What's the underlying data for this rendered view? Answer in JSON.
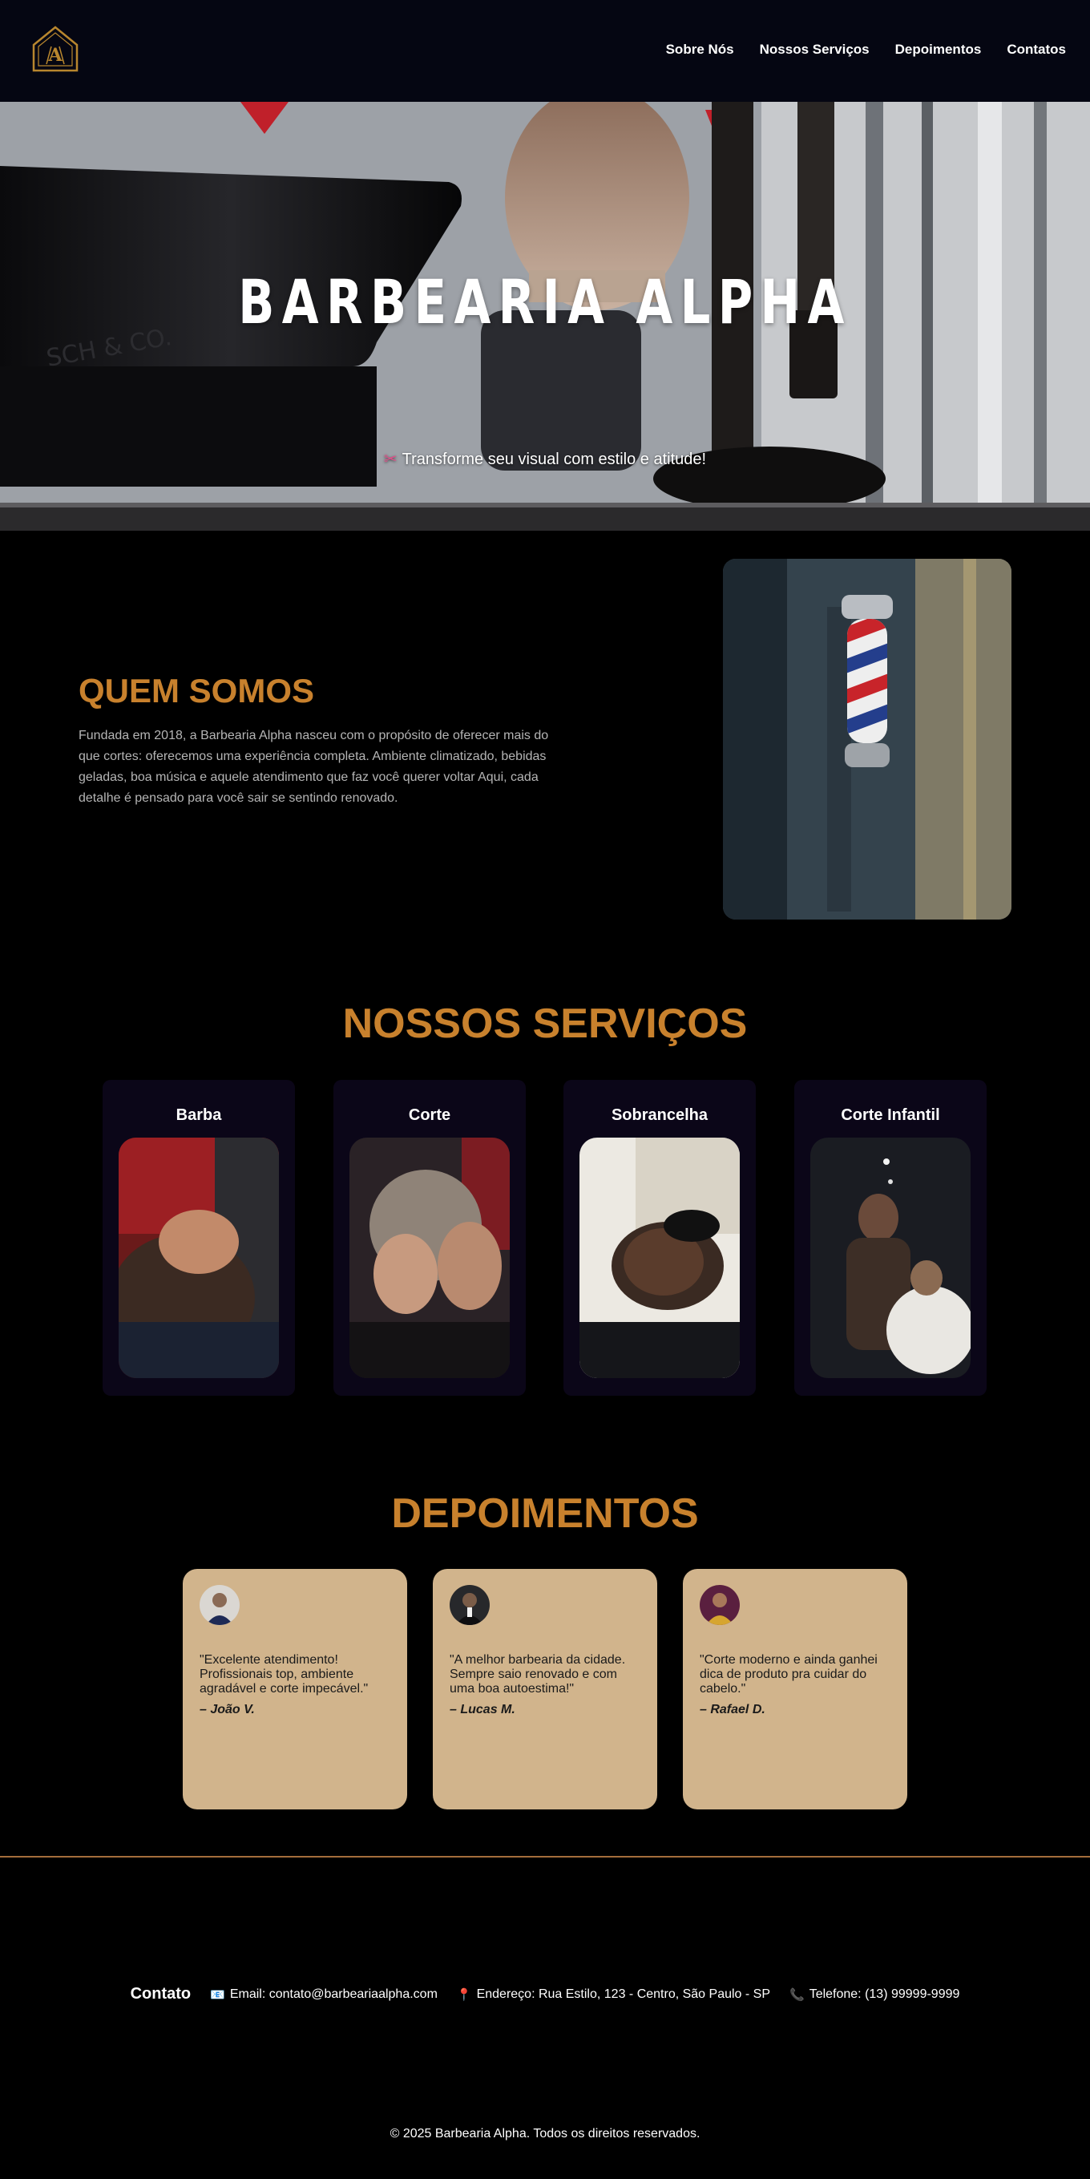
{
  "nav": {
    "logo_alt": "Barbearia Alpha logo",
    "links": [
      "Sobre Nós",
      "Nossos Serviços",
      "Depoimentos",
      "Contatos"
    ]
  },
  "hero": {
    "title": "BARBEARIA ALPHA",
    "subtitle_icon": "scissors-icon",
    "subtitle": "Transforme seu visual com estilo e atitude!"
  },
  "about": {
    "title": "QUEM SOMOS",
    "text": "Fundada em 2018, a Barbearia Alpha nasceu com o propósito de oferecer mais do que cortes: oferecemos uma experiência completa. Ambiente climatizado, bebidas geladas, boa música e aquele atendimento que faz você querer voltar Aqui, cada detalhe é pensado para você sair se sentindo renovado."
  },
  "services": {
    "title": "NOSSOS SERVIÇOS",
    "items": [
      {
        "label": "Barba"
      },
      {
        "label": "Corte"
      },
      {
        "label": "Sobrancelha"
      },
      {
        "label": "Corte Infantil"
      }
    ]
  },
  "testimonials": {
    "title": "DEPOIMENTOS",
    "items": [
      {
        "quote": "\"Excelente atendimento! Profissionais top, ambiente agradável e corte impecável.\"",
        "author": "– João V."
      },
      {
        "quote": "\"A melhor barbearia da cidade. Sempre saio renovado e com uma boa autoestima!\"",
        "author": "– Lucas M."
      },
      {
        "quote": "\"Corte moderno e ainda ganhei dica de produto pra cuidar do cabelo.\"",
        "author": "– Rafael D."
      }
    ]
  },
  "contact": {
    "label": "Contato",
    "email": "Email: contato@barbeariaalpha.com",
    "address": "Endereço: Rua Estilo, 123 - Centro, São Paulo - SP",
    "phone": "Telefone: (13) 99999-9999"
  },
  "footer": {
    "copyright": "© 2025 Barbearia Alpha. Todos os direitos reservados."
  },
  "colors": {
    "accent": "#c8812d",
    "nav_bg": "#050612",
    "card_bg": "#0b0618",
    "testimonial_bg": "#d1b48c"
  }
}
